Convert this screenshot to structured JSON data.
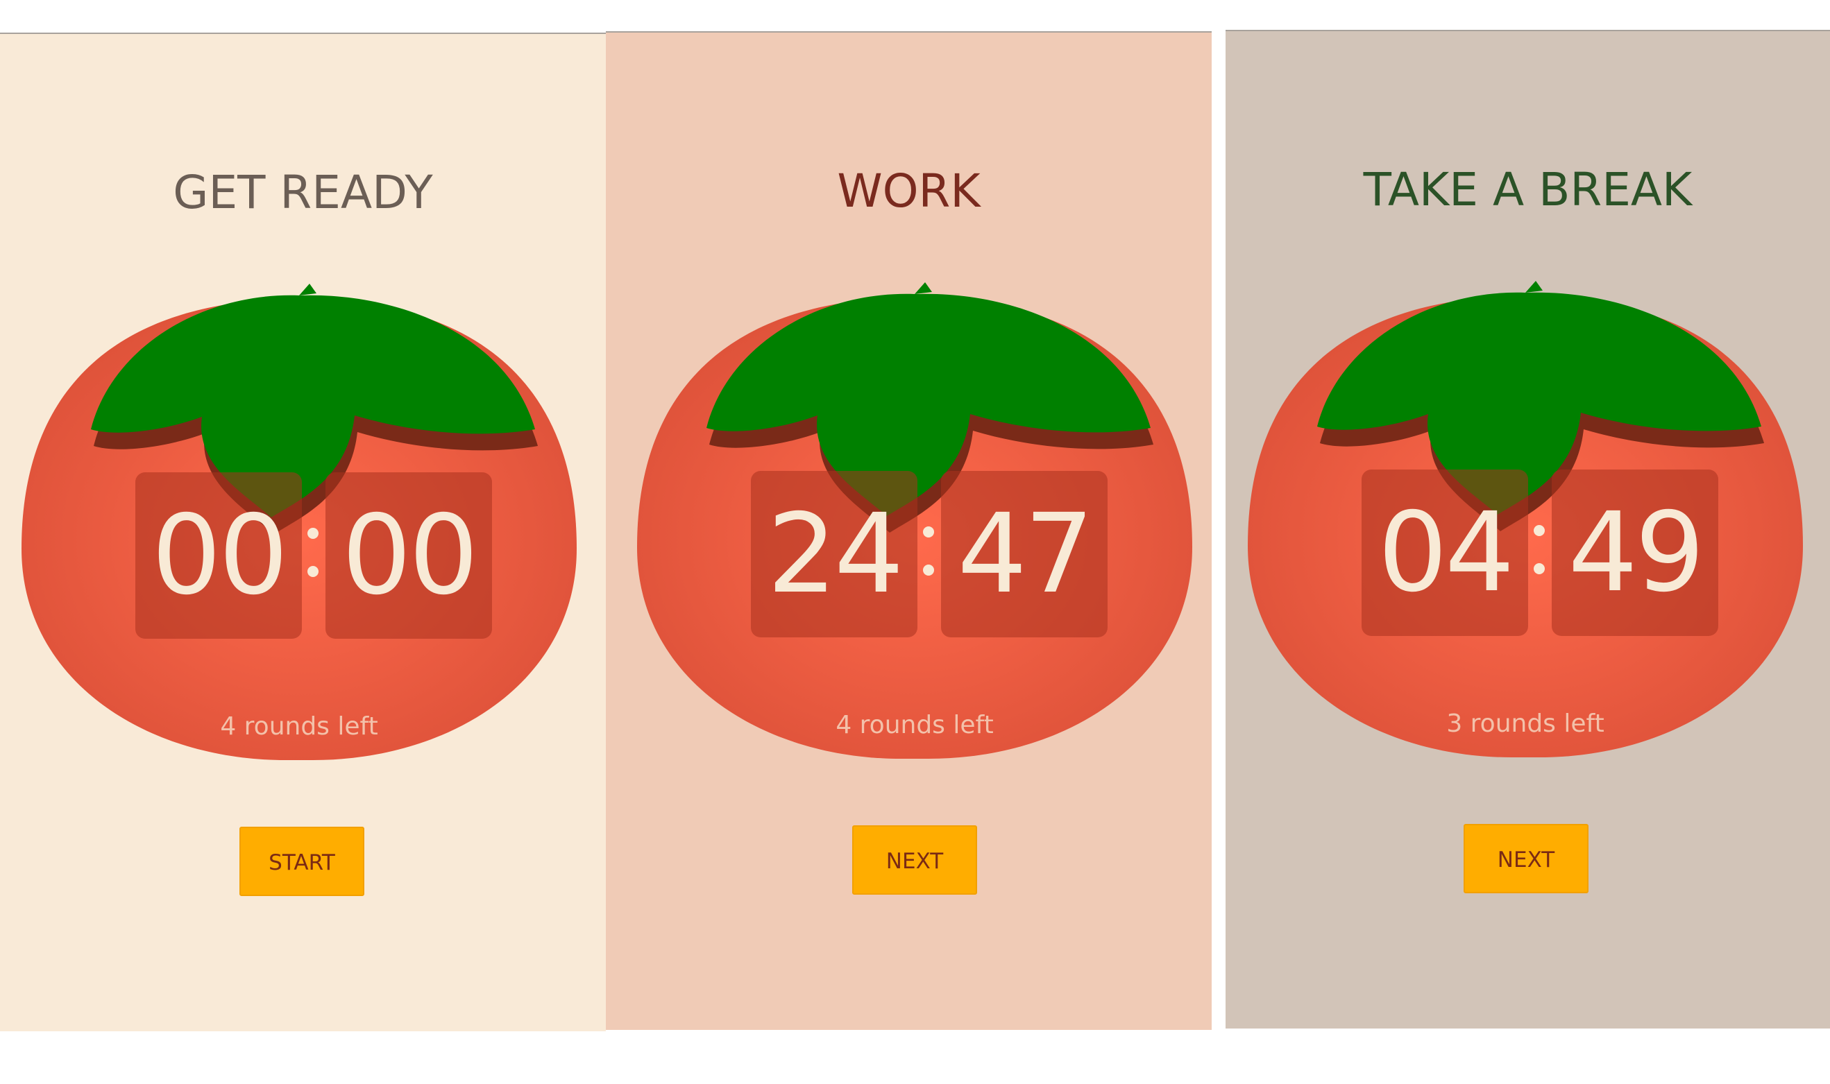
{
  "colors": {
    "accent_button": "#ffad00",
    "leaf": "#008000",
    "tomato": "#e85a40"
  },
  "panels": [
    {
      "title": "GET READY",
      "title_color": "#6b5e55",
      "background": "#f9ead7",
      "minutes": "00",
      "seconds": "00",
      "rounds_text": "4 rounds left",
      "button_label": "START"
    },
    {
      "title": "WORK",
      "title_color": "#7a2a1e",
      "background": "#f0cbb6",
      "minutes": "24",
      "seconds": "47",
      "rounds_text": "4 rounds left",
      "button_label": "NEXT"
    },
    {
      "title": "TAKE A BREAK",
      "title_color": "#2b5227",
      "background": "#d2c4b8",
      "minutes": "04",
      "seconds": "49",
      "rounds_text": "3 rounds left",
      "button_label": "NEXT"
    }
  ],
  "icons": {
    "tomato": "tomato-icon",
    "leaves": "leaves-icon"
  }
}
